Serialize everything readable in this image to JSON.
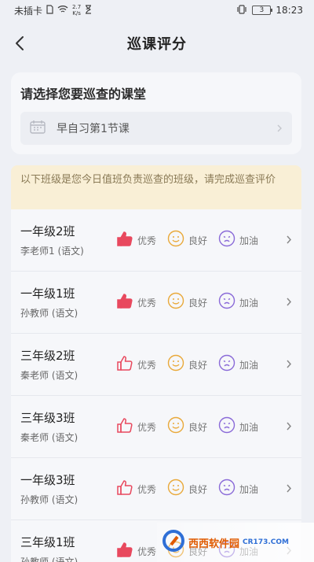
{
  "status": {
    "carrier": "未插卡",
    "speed_value": "2.7",
    "speed_unit": "K/s",
    "battery_level": "3",
    "time": "18:23"
  },
  "nav": {
    "title": "巡课评分"
  },
  "selector": {
    "title": "请选择您要巡查的课堂",
    "value": "早自习第1节课"
  },
  "notice": "以下班级是您今日值班负责巡查的班级，请完成巡查评价",
  "rating_labels": {
    "excellent": "优秀",
    "good": "良好",
    "effort": "加油"
  },
  "classes": [
    {
      "name": "一年级2班",
      "teacher": "李老师1 (语文)",
      "excellent_selected": true
    },
    {
      "name": "一年级1班",
      "teacher": "孙教师 (语文)",
      "excellent_selected": true
    },
    {
      "name": "三年级2班",
      "teacher": "秦老师 (语文)",
      "excellent_selected": false
    },
    {
      "name": "三年级3班",
      "teacher": "秦老师 (语文)",
      "excellent_selected": false
    },
    {
      "name": "一年级3班",
      "teacher": "孙教师 (语文)",
      "excellent_selected": false
    },
    {
      "name": "三年级1班",
      "teacher": "孙教师 (语文)",
      "excellent_selected": true
    }
  ],
  "colors": {
    "like_filled": "#e8495e",
    "like_outline": "#e8495e",
    "good_face": "#e9a93a",
    "effort_face": "#8a6ad8"
  },
  "watermark": {
    "brand": "西西软件园",
    "domain": "CR173.COM"
  }
}
